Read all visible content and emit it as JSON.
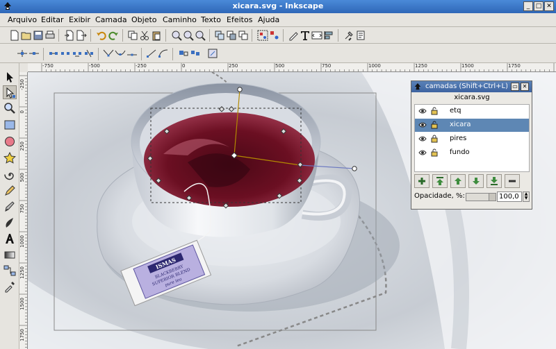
{
  "window": {
    "title": "xicara.svg - Inkscape",
    "buttons": [
      "_",
      "□",
      "✕"
    ]
  },
  "menu": [
    "Arquivo",
    "Editar",
    "Exibir",
    "Camada",
    "Objeto",
    "Caminho",
    "Texto",
    "Efeitos",
    "Ajuda"
  ],
  "toolbar_icons": [
    "new-icon",
    "open-icon",
    "save-icon",
    "print-icon",
    "import-icon",
    "export-icon",
    "undo-icon",
    "redo-icon",
    "copy-icon",
    "cut-icon",
    "paste-icon",
    "zoom-selection-icon",
    "zoom-drawing-icon",
    "zoom-page-icon",
    "duplicate-icon",
    "clone-icon",
    "unlink-clone-icon",
    "group-icon",
    "ungroup-icon",
    "fill-stroke-icon",
    "text-font-icon",
    "xml-editor-icon",
    "align-icon",
    "preferences-icon"
  ],
  "node_toolbar_icons": [
    "insert-node-icon",
    "delete-node-icon",
    "join-nodes-icon",
    "break-path-icon",
    "join-segment-icon",
    "delete-segment-icon",
    "cusp-node-icon",
    "smooth-node-icon",
    "symmetric-node-icon",
    "to-line-icon",
    "to-curve-icon",
    "object-to-path-icon",
    "stroke-to-path-icon",
    "show-handles-icon"
  ],
  "tools": [
    "selector-icon",
    "node-editor-icon",
    "zoom-icon",
    "rectangle-icon",
    "ellipse-icon",
    "star-icon",
    "spiral-icon",
    "pencil-icon",
    "pen-icon",
    "calligraphy-icon",
    "text-icon",
    "gradient-icon",
    "connector-icon",
    "dropper-icon"
  ],
  "ruler": {
    "h_labels": [
      "-750",
      "-500",
      "-250",
      "0",
      "250",
      "500",
      "750",
      "1000",
      "1250",
      "1500",
      "1750"
    ],
    "v_labels": [
      "-250",
      "0",
      "250",
      "500",
      "750",
      "1000",
      "1250",
      "1500",
      "1750"
    ]
  },
  "canvas": {
    "tag": {
      "title": "ISMAS",
      "line1": "BLACKBERRY",
      "line2": "SUPERIOR BLEND",
      "line3": "pure tea"
    }
  },
  "layers_dialog": {
    "title": "camadas (Shift+Ctrl+L)",
    "document": "xicara.svg",
    "layers": [
      {
        "name": "etq",
        "selected": false
      },
      {
        "name": "xicara",
        "selected": true
      },
      {
        "name": "pires",
        "selected": false
      },
      {
        "name": "fundo",
        "selected": false
      }
    ],
    "opacity_label": "Opacidade, %:",
    "opacity_value": "100,0",
    "opacity": 1.0
  },
  "colors": {
    "tea": "#6b0f22",
    "title_bar": "#3c76c8",
    "selected_layer": "#5e87b4"
  }
}
